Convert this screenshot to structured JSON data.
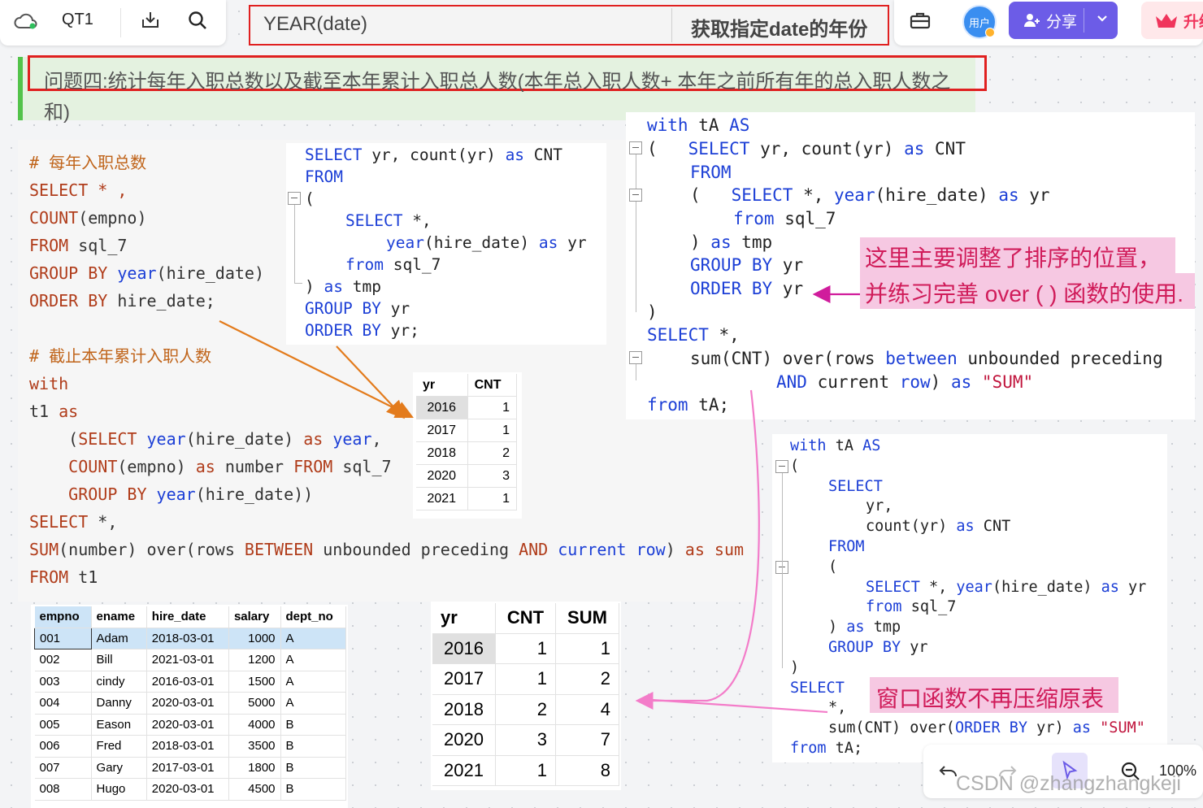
{
  "toolbar": {
    "doc_name": "QT1",
    "formula_name": "YEAR(date)",
    "formula_desc": "获取指定date的年份",
    "avatar_label": "用户",
    "share_label": "分享",
    "upgrade_label": "升级"
  },
  "question": {
    "line1": "问题四:统计每年入职总数以及截至本年累计入职总人数(本年总入职人数+ 本年之前所有年的总入职人数之",
    "line2": "和)"
  },
  "left_code": {
    "comment1": "# 每年入职总数",
    "l1": "SELECT * ,",
    "l2_fn": "COUNT",
    "l2_rest": "(empno)",
    "l3_kw": "FROM",
    "l3_rest": " sql_7",
    "l4_kw": "GROUP BY",
    "l4_fn": " year",
    "l4_rest": "(hire_date)",
    "l5_kw": "ORDER BY",
    "l5_rest": " hire_date;",
    "comment2": "# 截止本年累计入职人数",
    "l6": "with",
    "l7_a": "t1 ",
    "l7_kw": "as",
    "l8_a": "    (",
    "l8_kw1": "SELECT",
    "l8_fn": " year",
    "l8_b": "(hire_date) ",
    "l8_kw2": "as",
    "l8_c": " year",
    "l8_d": ",",
    "l9_a": "    ",
    "l9_fn": "COUNT",
    "l9_b": "(empno) ",
    "l9_kw1": "as",
    "l9_c": " number ",
    "l9_kw2": "FROM",
    "l9_d": " sql_7",
    "l10_a": "    ",
    "l10_kw": "GROUP BY",
    "l10_fn": " year",
    "l10_b": "(hire_date))",
    "l11_kw": "SELECT",
    "l11_rest": " *,",
    "l12_fn": "SUM",
    "l12_a": "(number) over(rows ",
    "l12_kw1": "BETWEEN",
    "l12_b": " unbounded preceding ",
    "l12_kw2": "AND",
    "l12_c": " ",
    "l12_kw3": "current row",
    "l12_d": ") ",
    "l12_kw4": "as",
    "l12_e": " sum",
    "l13_kw": "FROM",
    "l13_rest": " t1"
  },
  "mid_code": {
    "l1_kw": "SELECT",
    "l1_a": " yr, count(yr) ",
    "l1_kw2": "as",
    "l1_b": " CNT",
    "l2": "FROM",
    "l3": "(",
    "l4_kw": "SELECT",
    "l4_a": " *,",
    "l5_fn": "year",
    "l5_a": "(hire_date) ",
    "l5_kw": "as",
    "l5_b": " yr",
    "l6_kw": "from",
    "l6_a": " sql_7",
    "l7_a": ") ",
    "l7_kw": "as",
    "l7_b": " tmp",
    "l8_kw": "GROUP BY",
    "l8_a": " yr",
    "l9_kw": "ORDER BY",
    "l9_a": " yr;"
  },
  "small_table": {
    "headers": [
      "yr",
      "CNT"
    ],
    "rows": [
      [
        "2016",
        "1"
      ],
      [
        "2017",
        "1"
      ],
      [
        "2018",
        "2"
      ],
      [
        "2020",
        "3"
      ],
      [
        "2021",
        "1"
      ]
    ]
  },
  "right_code": {
    "l1_kw": "with",
    "l1_a": " tA ",
    "l1_kw2": "AS",
    "l2_a": "(   ",
    "l2_kw": "SELECT",
    "l2_b": " yr, count(yr) ",
    "l2_kw2": "as",
    "l2_c": " CNT",
    "l3": "FROM",
    "l4_a": "(   ",
    "l4_kw": "SELECT",
    "l4_b": " *, ",
    "l4_fn": "year",
    "l4_c": "(hire_date) ",
    "l4_kw2": "as",
    "l4_d": " yr",
    "l5_kw": "from",
    "l5_a": " sql_7",
    "l6_a": ") ",
    "l6_kw": "as",
    "l6_b": " tmp",
    "l7_kw": "GROUP BY",
    "l7_a": " yr",
    "l8_kw": "ORDER BY",
    "l8_a": " yr",
    "l9": ")",
    "l10_kw": "SELECT",
    "l10_a": " *,",
    "l11_a": "sum(CNT) over(rows ",
    "l11_kw": "between",
    "l11_b": " unbounded preceding",
    "l12_kw": "AND",
    "l12_a": " current ",
    "l12_kw2": "row",
    "l12_b": ") ",
    "l12_kw3": "as",
    "l12_str": " \"SUM\"",
    "l13_kw": "from",
    "l13_a": " tA;"
  },
  "annotation1": {
    "line1": "这里主要调整了排序的位置，",
    "line2": "并练习完善 over ( ) 函数的使用."
  },
  "right_code2": {
    "l1_kw": "with",
    "l1_a": " tA ",
    "l1_kw2": "AS",
    "l2": "(",
    "l3": "SELECT",
    "l4": "yr,",
    "l5_a": "count(yr) ",
    "l5_kw": "as",
    "l5_b": " CNT",
    "l6": "FROM",
    "l7": "(",
    "l8_kw": "SELECT",
    "l8_a": " *, ",
    "l8_fn": "year",
    "l8_b": "(hire_date) ",
    "l8_kw2": "as",
    "l8_c": " yr",
    "l9_kw": "from",
    "l9_a": " sql_7",
    "l10_a": ") ",
    "l10_kw": "as",
    "l10_b": " tmp",
    "l11_kw": "GROUP BY",
    "l11_a": " yr",
    "l12": ")",
    "l13": "SELECT",
    "l14": "*,",
    "l15_a": "sum(CNT) over(",
    "l15_kw": "ORDER BY",
    "l15_b": " yr) ",
    "l15_kw2": "as",
    "l15_str": " \"SUM\"",
    "l16_kw": "from",
    "l16_a": " tA;"
  },
  "annotation2": "窗口函数不再压缩原表",
  "emp_table": {
    "headers": [
      "empno",
      "ename",
      "hire_date",
      "salary",
      "dept_no"
    ],
    "rows": [
      [
        "001",
        "Adam",
        "2018-03-01",
        "1000",
        "A"
      ],
      [
        "002",
        "Bill",
        "2021-03-01",
        "1200",
        "A"
      ],
      [
        "003",
        "cindy",
        "2016-03-01",
        "1500",
        "A"
      ],
      [
        "004",
        "Danny",
        "2020-03-01",
        "5000",
        "A"
      ],
      [
        "005",
        "Eason",
        "2020-03-01",
        "4000",
        "B"
      ],
      [
        "006",
        "Fred",
        "2018-03-01",
        "3500",
        "B"
      ],
      [
        "007",
        "Gary",
        "2017-03-01",
        "1800",
        "B"
      ],
      [
        "008",
        "Hugo",
        "2020-03-01",
        "4500",
        "B"
      ]
    ]
  },
  "big_table": {
    "headers": [
      "yr",
      "CNT",
      "SUM"
    ],
    "rows": [
      [
        "2016",
        "1",
        "1"
      ],
      [
        "2017",
        "1",
        "2"
      ],
      [
        "2018",
        "2",
        "4"
      ],
      [
        "2020",
        "3",
        "7"
      ],
      [
        "2021",
        "1",
        "8"
      ]
    ]
  },
  "bottom_bar": {
    "zoom": "100%",
    "watermark": "CSDN @zhangzhangkeji"
  },
  "colors": {
    "accent": "#6c5ce7",
    "highlight_red": "#e02020",
    "annotation_pink": "#f5c6e0",
    "arrow_orange": "#e37b1c",
    "arrow_pink": "#f37cc9"
  }
}
